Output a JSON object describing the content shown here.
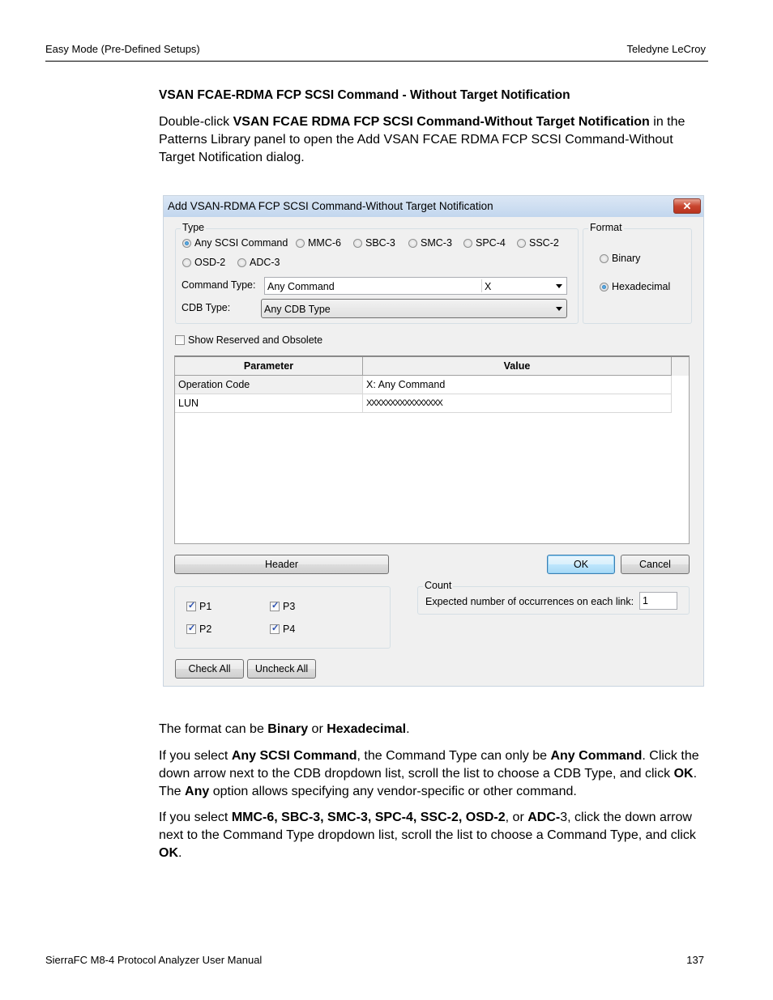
{
  "page": {
    "header_left": "Easy Mode (Pre-Defined Setups)",
    "header_right": "Teledyne  LeCroy",
    "section_title": "VSAN FCAE-RDMA FCP SCSI Command - Without Target Notification",
    "intro": {
      "t1": "Double-click ",
      "b1": "VSAN FCAE RDMA FCP SCSI Command-Without Target Notification",
      "t2": " in the Patterns Library panel to open the Add VSAN FCAE RDMA FCP SCSI Command-Without Target Notification dialog."
    },
    "para_format": {
      "t1": "The format can be ",
      "b1": "Binary",
      "t2": " or ",
      "b2": "Hexadecimal",
      "t3": "."
    },
    "para_any": {
      "t1": "If you select ",
      "b1": "Any SCSI Command",
      "t2": ", the Command Type can only be ",
      "b2": "Any Command",
      "t3": ". Click the down arrow next to the CDB dropdown list, scroll the list to choose a CDB Type, and click ",
      "b3": "OK",
      "t4": ". The ",
      "b4": "Any",
      "t5": " option allows specifying any vendor-specific or other command."
    },
    "para_specific": {
      "t1": "If you select ",
      "b1": "MMC-6, SBC-3, SMC-3, SPC-4, SSC-2, OSD-2",
      "t2": ", or ",
      "b2": "ADC-",
      "t3": "3, click the down arrow next to the Command Type dropdown list, scroll the list to choose a Command Type, and click ",
      "b3": "OK",
      "t4": "."
    },
    "footer_left": "SierraFC M8-4 Protocol Analyzer User Manual",
    "footer_right": "137"
  },
  "dialog": {
    "title": "Add VSAN-RDMA FCP SCSI Command-Without Target Notification",
    "close_glyph": "✕",
    "type_group": {
      "label": "Type",
      "options": [
        {
          "label": "Any SCSI Command",
          "selected": true
        },
        {
          "label": "MMC-6",
          "selected": false
        },
        {
          "label": "SBC-3",
          "selected": false
        },
        {
          "label": "SMC-3",
          "selected": false
        },
        {
          "label": "SPC-4",
          "selected": false
        },
        {
          "label": "SSC-2",
          "selected": false
        },
        {
          "label": "OSD-2",
          "selected": false
        },
        {
          "label": "ADC-3",
          "selected": false
        }
      ],
      "command_type_label": "Command Type:",
      "command_type_value": "Any Command",
      "command_type_code": "X",
      "cdb_type_label": "CDB Type:",
      "cdb_type_value": "Any CDB Type"
    },
    "format_group": {
      "label": "Format",
      "options": [
        {
          "label": "Binary",
          "selected": false
        },
        {
          "label": "Hexadecimal",
          "selected": true
        }
      ]
    },
    "show_reserved": {
      "label": "Show Reserved and Obsolete",
      "checked": false
    },
    "grid": {
      "columns": [
        "Parameter",
        "Value"
      ],
      "rows": [
        {
          "parameter": "Operation Code",
          "value": "X: Any Command"
        },
        {
          "parameter": "LUN",
          "value": "XXXXXXXXXXXXXXXX"
        }
      ]
    },
    "buttons": {
      "header": "Header",
      "ok": "OK",
      "cancel": "Cancel",
      "check_all": "Check All",
      "uncheck_all": "Uncheck All"
    },
    "ports": [
      {
        "label": "P1",
        "checked": true
      },
      {
        "label": "P3",
        "checked": true
      },
      {
        "label": "P2",
        "checked": true
      },
      {
        "label": "P4",
        "checked": true
      }
    ],
    "count_group": {
      "label": "Count",
      "field_label": "Expected number of occurrences on each link:",
      "value": "1"
    }
  }
}
